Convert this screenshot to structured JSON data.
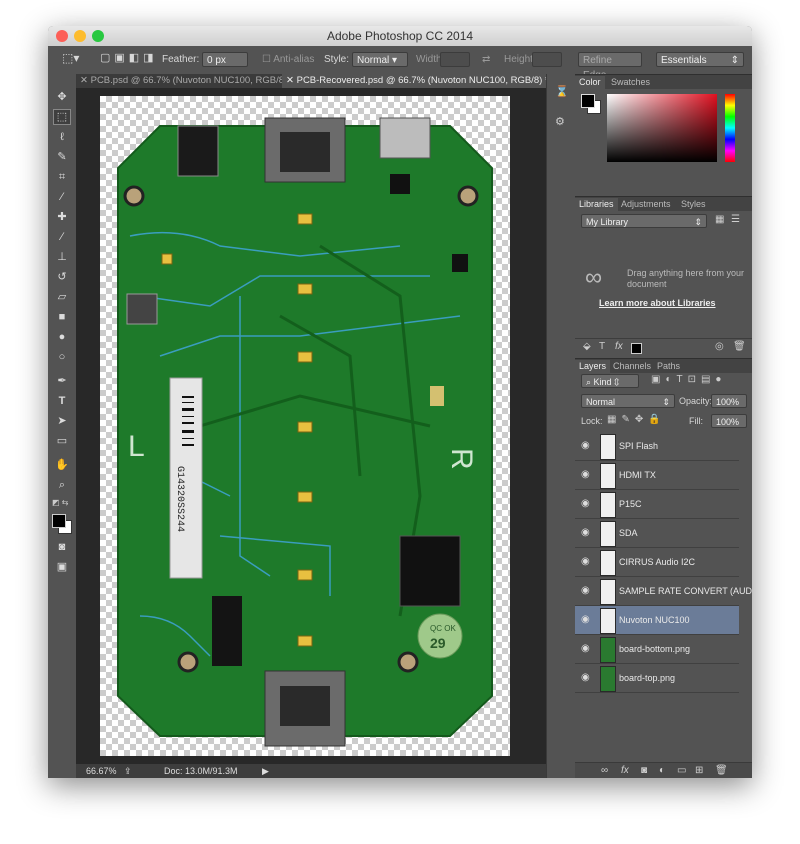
{
  "app": {
    "title": "Adobe Photoshop CC 2014"
  },
  "options": {
    "feather_label": "Feather:",
    "feather_value": "0 px",
    "antialias": "Anti-alias",
    "style_label": "Style:",
    "style_value": "Normal",
    "width_label": "Width:",
    "height_label": "Height:",
    "refine_edge": "Refine Edge...",
    "workspace": "Essentials"
  },
  "tabs": [
    {
      "label": "PCB.psd @ 66.7% (Nuvoton NUC100, RGB/8)"
    },
    {
      "label": "PCB-Recovered.psd @ 66.7% (Nuvoton NUC100, RGB/8) *"
    }
  ],
  "status": {
    "zoom": "66.67%",
    "doc": "Doc: 13.0M/91.3M"
  },
  "panels": {
    "color_tabs": [
      "Color",
      "Swatches"
    ],
    "lib_tabs": [
      "Libraries",
      "Adjustments",
      "Styles"
    ],
    "library_select": "My Library",
    "library_empty": "Drag anything here from your document",
    "library_link": "Learn more about Libraries",
    "layers_tabs": [
      "Layers",
      "Channels",
      "Paths"
    ],
    "kind_filter": "Kind",
    "blend_mode": "Normal",
    "opacity_label": "Opacity:",
    "opacity_value": "100%",
    "lock_label": "Lock:",
    "fill_label": "Fill:",
    "fill_value": "100%"
  },
  "layers": [
    {
      "name": "SPI Flash",
      "thumb": "white"
    },
    {
      "name": "HDMI TX",
      "thumb": "white"
    },
    {
      "name": "P15C",
      "thumb": "white"
    },
    {
      "name": "SDA",
      "thumb": "white"
    },
    {
      "name": "CIRRUS Audio I2C",
      "thumb": "white"
    },
    {
      "name": "SAMPLE RATE CONVERT (AUDIO)",
      "thumb": "white"
    },
    {
      "name": "Nuvoton NUC100",
      "thumb": "white",
      "selected": true
    },
    {
      "name": "board-bottom.png",
      "thumb": "pcb"
    },
    {
      "name": "board-top.png",
      "thumb": "pcb"
    }
  ],
  "pcb": {
    "barcode_text": "G14320SS244",
    "sticker_text": "QC OK",
    "sticker_number": "29"
  },
  "colors": {
    "pcb_green": "#1e7a2a",
    "trace_blue": "#3fa4d8",
    "selection": "#6b7c98"
  }
}
